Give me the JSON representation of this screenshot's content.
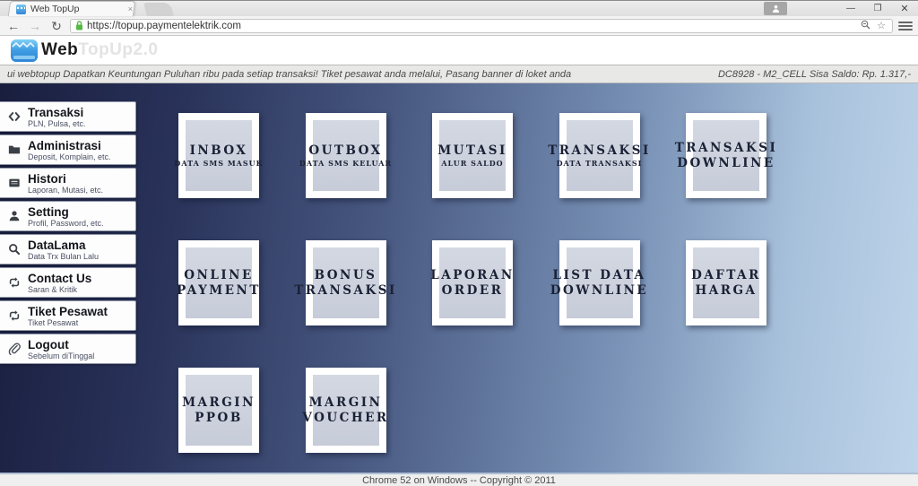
{
  "colors": {
    "gradient_left": "#191e3e",
    "gradient_right": "#bed4ea",
    "tile_bg": "#cbd0dc",
    "padlock_green": "#57b845",
    "card_bg": "#fdfdfd"
  },
  "browser": {
    "tab_title": "Web TopUp",
    "url": "https://topup.paymentelektrik.com",
    "close_tab_glyph": "×",
    "back_glyph": "←",
    "forward_glyph": "→",
    "reload_glyph": "↻",
    "star_glyph": "☆",
    "minimize_glyph": "—",
    "restore_glyph": "❐",
    "close_glyph": "✕"
  },
  "header": {
    "brand_bold": "Web",
    "brand_light": "TopUp2.0"
  },
  "ticker": {
    "message": "ui webtopup Dapatkan Keuntungan Puluhan ribu pada setiap transaksi! Tiket pesawat anda melalui, Pasang banner di loket anda",
    "account": "DC8928 - M2_CELL Sisa Saldo: Rp. 1.317,-"
  },
  "sidebar": {
    "items": [
      {
        "icon": "code-icon",
        "label": "Transaksi",
        "sub": "PLN, Pulsa, etc."
      },
      {
        "icon": "folder-icon",
        "label": "Administrasi",
        "sub": "Deposit, Komplain, etc."
      },
      {
        "icon": "archive-icon",
        "label": "Histori",
        "sub": "Laporan, Mutasi, etc."
      },
      {
        "icon": "user-icon",
        "label": "Setting",
        "sub": "Profil, Password, etc."
      },
      {
        "icon": "search-icon",
        "label": "DataLama",
        "sub": "Data Trx Bulan Lalu"
      },
      {
        "icon": "retweet-icon",
        "label": "Contact Us",
        "sub": "Saran & Kritik"
      },
      {
        "icon": "retweet-icon",
        "label": "Tiket Pesawat",
        "sub": "Tiket Pesawat"
      },
      {
        "icon": "paperclip-icon",
        "label": "Logout",
        "sub": "Sebelum diTinggal"
      }
    ]
  },
  "tiles": [
    {
      "id": "inbox",
      "line1": "INBOX",
      "line2": "DATA SMS MASUK",
      "big": false
    },
    {
      "id": "outbox",
      "line1": "OUTBOX",
      "line2": "DATA SMS KELUAR",
      "big": false
    },
    {
      "id": "mutasi",
      "line1": "MUTASI",
      "line2": "ALUR SALDO",
      "big": false
    },
    {
      "id": "transaksi",
      "line1": "TRANSAKSI",
      "line2": "DATA TRANSAKSI",
      "big": false
    },
    {
      "id": "transaksi-downline",
      "line1": "TRANSAKSI",
      "line2": "DOWNLINE",
      "big": true
    },
    {
      "id": "online-payment",
      "line1": "ONLINE",
      "line2": "PAYMENT",
      "big": true
    },
    {
      "id": "bonus-transaksi",
      "line1": "BONUS",
      "line2": "TRANSAKSI",
      "big": true
    },
    {
      "id": "laporan-order",
      "line1": "LAPORAN",
      "line2": "ORDER",
      "big": true
    },
    {
      "id": "list-data-downline",
      "line1": "LIST DATA",
      "line2": "DOWNLINE",
      "big": true
    },
    {
      "id": "daftar-harga",
      "line1": "DAFTAR",
      "line2": "HARGA",
      "big": true
    },
    {
      "id": "margin-ppob",
      "line1": "MARGIN",
      "line2": "PPOB",
      "big": true
    },
    {
      "id": "margin-voucher",
      "line1": "MARGIN",
      "line2": "VOUCHER",
      "big": true
    }
  ],
  "footer": {
    "text": "Chrome 52 on Windows -- Copyright © 2011"
  }
}
